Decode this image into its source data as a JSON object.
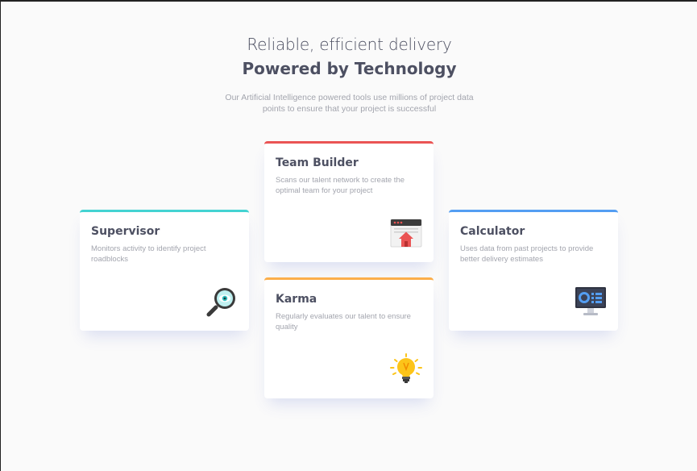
{
  "header": {
    "subtitle": "Reliable, efficient delivery",
    "title": "Powered by Technology",
    "intro": "Our Artificial Intelligence powered tools use millions of project data points to ensure that your project is successful"
  },
  "cards": {
    "supervisor": {
      "title": "Supervisor",
      "description": "Monitors activity to identify project roadblocks",
      "icon": "magnifying-glass-eye-icon",
      "accent": "#44d3d2"
    },
    "team_builder": {
      "title": "Team Builder",
      "description": "Scans our talent network to create the optimal team for your project",
      "icon": "browser-window-home-icon",
      "accent": "#ea5454"
    },
    "karma": {
      "title": "Karma",
      "description": "Regularly evaluates our talent to ensure quality",
      "icon": "lightbulb-icon",
      "accent": "#fcae4a"
    },
    "calculator": {
      "title": "Calculator",
      "description": "Uses data from past projects to provide better delivery estimates",
      "icon": "monitor-dashboard-icon",
      "accent": "#549ef2"
    }
  }
}
